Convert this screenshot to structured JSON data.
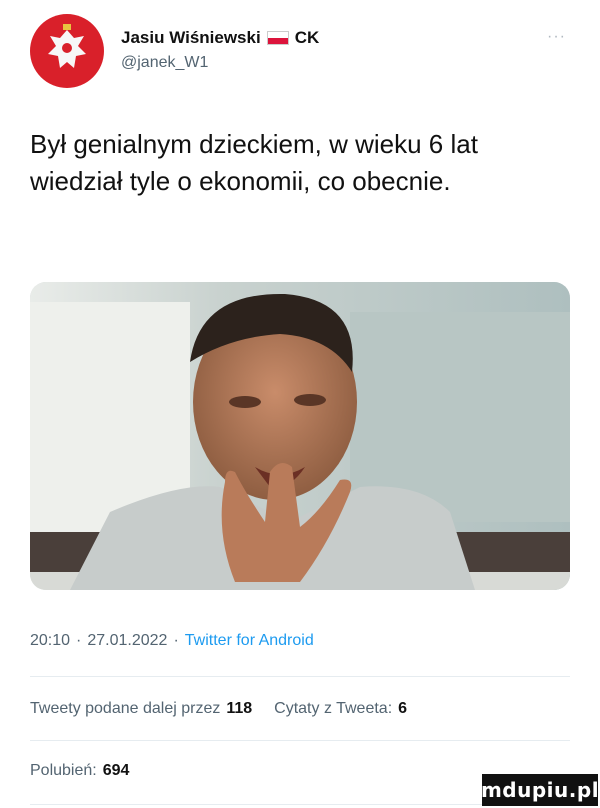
{
  "author": {
    "display_name": "Jasiu Wiśniewski",
    "badge": "CK",
    "handle": "@janek_W1",
    "avatar_icon": "polish-eagle-emblem-icon",
    "flag_icon": "poland-flag-icon",
    "more_icon": "more-options-icon",
    "more_glyph": "···"
  },
  "tweet": {
    "text": "Był genialnym dzieckiem, w wieku 6 lat wiedział tyle o ekonomii, co obecnie.",
    "image_description_icon": "photo-man-thinking"
  },
  "meta": {
    "time": "20:10",
    "sep1": "·",
    "date": "27.01.2022",
    "sep2": "·",
    "source": "Twitter for Android"
  },
  "stats": {
    "retweets_label": "Tweety podane dalej przez",
    "retweets_count": "118",
    "quotes_label": "Cytaty z Tweeta:",
    "quotes_count": "6",
    "likes_label": "Polubień:",
    "likes_count": "694"
  },
  "watermark": {
    "text": "mdupiu.pl"
  },
  "colors": {
    "text": "#111111",
    "secondary": "#536471",
    "link": "#1d9bf0",
    "divider": "#e6ecf0",
    "flag_red": "#dc143c"
  }
}
